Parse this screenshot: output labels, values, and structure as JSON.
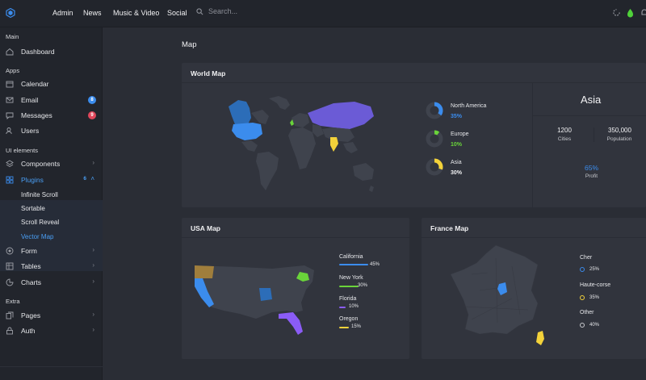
{
  "topbar": {
    "nav": [
      "Admin",
      "News",
      "Music & Video",
      "Social"
    ],
    "search_placeholder": "Search..."
  },
  "sidebar": {
    "sections": {
      "main": "Main",
      "apps": "Apps",
      "ui_elements": "UI elements",
      "extra": "Extra"
    },
    "items": {
      "dashboard": "Dashboard",
      "calendar": "Calendar",
      "email": "Email",
      "email_badge": "8",
      "messages": "Messages",
      "messages_badge": "9",
      "users": "Users",
      "components": "Components",
      "plugins": "Plugins",
      "plugins_badge": "6",
      "form": "Form",
      "tables": "Tables",
      "charts": "Charts",
      "pages": "Pages",
      "auth": "Auth"
    },
    "plugins_sub": [
      "Infinite Scroll",
      "Sortable",
      "Scroll Reveal",
      "Vector Map"
    ]
  },
  "page": {
    "title": "Map"
  },
  "world_map": {
    "title": "World Map",
    "regions": [
      {
        "name": "North America",
        "pct": "35%",
        "value": 35,
        "color": "#3b8ced"
      },
      {
        "name": "Europe",
        "pct": "10%",
        "value": 10,
        "color": "#6ad43a"
      },
      {
        "name": "Asia",
        "pct": "30%",
        "value": 30,
        "color": "#f3d23a"
      }
    ],
    "stats": {
      "region": "Asia",
      "cities_value": "1200",
      "cities_label": "Cities",
      "population_value": "350,000",
      "population_label": "Population",
      "profit_value": "65%",
      "profit_label": "Profit"
    }
  },
  "usa_map": {
    "title": "USA Map",
    "legend": [
      {
        "name": "California",
        "pct": "45%",
        "value": 45,
        "color": "#3b8ced"
      },
      {
        "name": "New York",
        "pct": "30%",
        "value": 30,
        "color": "#6ad43a"
      },
      {
        "name": "Florida",
        "pct": "10%",
        "value": 10,
        "color": "#8b5cf6"
      },
      {
        "name": "Oregon",
        "pct": "15%",
        "value": 15,
        "color": "#f3d23a"
      }
    ]
  },
  "france_map": {
    "title": "France Map",
    "legend": [
      {
        "name": "Cher",
        "pct": "25%",
        "color": "#3b8ced"
      },
      {
        "name": "Haute-corse",
        "pct": "35%",
        "color": "#f3d23a"
      },
      {
        "name": "Other",
        "pct": "40%",
        "color": "#c8c9cd"
      }
    ]
  },
  "colors": {
    "accent": "#3b8ced",
    "green": "#6ad43a",
    "purple": "#6b5bd6",
    "yellow": "#f3d23a",
    "red_badge": "#e0475b"
  },
  "icons": {
    "logo": "hexagon-logo-icon",
    "search": "search-icon",
    "refresh": "refresh-icon",
    "status": "status-dot-icon",
    "notifications": "bell-icon"
  }
}
